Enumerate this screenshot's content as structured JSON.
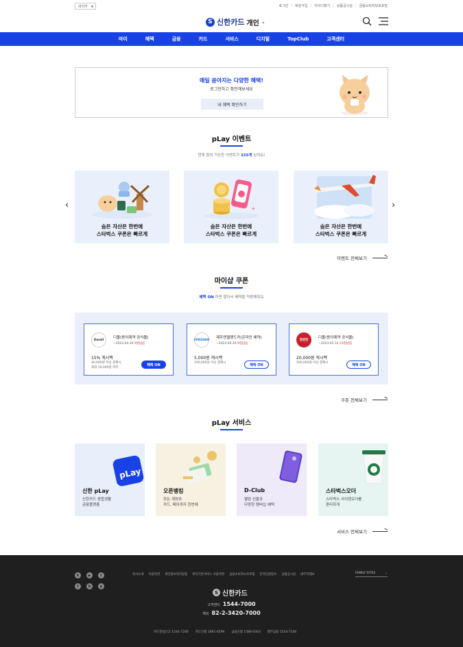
{
  "topbar": {
    "language": "마이카",
    "util_links": [
      "로그인",
      "회원가입",
      "아이디찾기",
      "상품공시실",
      "금융소비자보호포털"
    ]
  },
  "header": {
    "logo_text": "신한카드",
    "logo_sub": "개인",
    "nav": [
      "마이",
      "혜택",
      "금융",
      "카드",
      "서비스",
      "디지털",
      "TopClub",
      "고객센터"
    ]
  },
  "banner": {
    "title": "매일 쏟아지는 다양한 혜택!",
    "subtitle": "로그인하고 확인해보세요",
    "button": "내 혜택 확인하기"
  },
  "events": {
    "title": "pLay 이벤트",
    "sub_prefix": "현재 참여 가능한 이벤트가 ",
    "sub_count": "155개",
    "sub_suffix": " 있어요!",
    "cards": [
      {
        "line1": "숨은 자산은 한번에",
        "line2": "스타벅스 쿠폰은 빠르게"
      },
      {
        "line1": "숨은 자산은 한번에",
        "line2": "스타벅스 쿠폰은 빠르게"
      },
      {
        "line1": "숨은 자산은 한번에",
        "line2": "스타벅스 쿠폰은 빠르게"
      }
    ],
    "more": "이벤트 전체보기"
  },
  "coupons": {
    "title": "마이샵 쿠폰",
    "sub_highlight": "혜택 ON",
    "sub_rest": " 하면 쌓아서 혜택을 적용해줘요",
    "items": [
      {
        "logo": "Dmall",
        "name": "디몰(동아제약 공식몰)",
        "date": "~2023.04.30",
        "dday": "9일남음",
        "amount": "15% 캐시백",
        "cond1": "40,000원 이상 결제시,",
        "cond2": "최대 10,000원 까지",
        "button": "혜택 ON"
      },
      {
        "logo": "SPADIAM",
        "name": "제주엔젤랜드커(온라인 예약)",
        "date": "~2023.04.30",
        "dday": "9일남음",
        "amount": "5,000원 캐시백",
        "cond1": "100,000원 이상 결제시",
        "cond2": "",
        "button": "혜택 ON"
      },
      {
        "logo": "정관장",
        "name": "디몰(동아제약 공식몰)",
        "date": "~2023.05.14",
        "dday": "23일남음",
        "amount": "20,000원 캐시백",
        "cond1": "500,000원 이상 결제시",
        "cond2": "",
        "button": "혜택 ON"
      }
    ],
    "more": "쿠폰 전체보기"
  },
  "services": {
    "title": "pLay 서비스",
    "items": [
      {
        "name": "신한 pLay",
        "line1": "신한카드 종합생활",
        "line2": "금융플랫폼",
        "bg": "#e8eefa"
      },
      {
        "name": "오픈뱅킹",
        "line1": "모든 계좌와",
        "line2": "카드, 페이까지 한번에",
        "bg": "#f7f1e2"
      },
      {
        "name": "D-Club",
        "line1": "웰컴 선물과",
        "line2": "다양한 멤버십 혜택",
        "bg": "#eeeafa"
      },
      {
        "name": "스타벅스오더",
        "line1": "스타벅스 사이렌오더를",
        "line2": "편리하게",
        "bg": "#e6f5f2"
      }
    ],
    "more": "서비스 전체보기"
  },
  "footer": {
    "links": [
      "회사소개",
      "이용약관",
      "개인정보처리방침",
      "위치기반서비스 이용약관",
      "금융소비자보호포털",
      "전자민원접수",
      "상품공시실",
      "내부자제보"
    ],
    "family_sites": "FAMILY SITES",
    "logo_text": "신한카드",
    "cs_label": "고객센터",
    "cs_number": "1544-7000",
    "overseas_label": "해외",
    "overseas_number": "82-2-3420-7000",
    "numbers": [
      "카드분실신고 1544-7200",
      "카드신청 1661-8599",
      "금융신청 1588-0303",
      "할부금융 1544-7100"
    ]
  }
}
